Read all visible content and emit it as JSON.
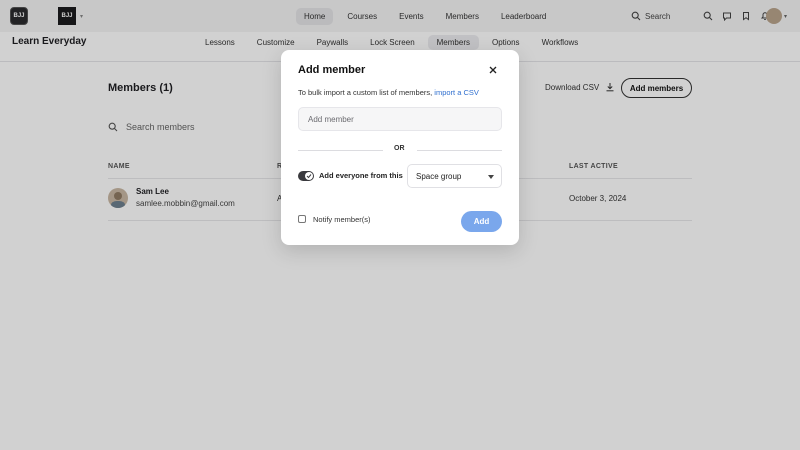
{
  "topnav": {
    "logo_left": "BJJ",
    "logo_right": "BJJ",
    "links": [
      {
        "label": "Home",
        "active": true
      },
      {
        "label": "Courses",
        "active": false
      },
      {
        "label": "Events",
        "active": false
      },
      {
        "label": "Members",
        "active": false
      },
      {
        "label": "Leaderboard",
        "active": false
      }
    ],
    "search_label": "Search",
    "icons": [
      "search-icon",
      "bell-icon",
      "chat-icon",
      "bookmark-icon"
    ]
  },
  "subnav": {
    "title": "Learn Everyday",
    "tabs": [
      {
        "label": "Lessons",
        "active": false
      },
      {
        "label": "Customize",
        "active": false
      },
      {
        "label": "Paywalls",
        "active": false
      },
      {
        "label": "Lock Screen",
        "active": false
      },
      {
        "label": "Members",
        "active": true
      },
      {
        "label": "Options",
        "active": false
      },
      {
        "label": "Workflows",
        "active": false
      }
    ]
  },
  "main": {
    "title": "Members (1)",
    "download_csv": "Download CSV",
    "add_members": "Add members",
    "search_placeholder": "Search members",
    "columns": {
      "name": "NAME",
      "role": "R",
      "last_active": "LAST ACTIVE"
    },
    "rows": [
      {
        "name": "Sam Lee",
        "email": "samlee.mobbin@gmail.com",
        "role": "A",
        "last_active": "October 3, 2024"
      }
    ]
  },
  "modal": {
    "title": "Add member",
    "desc_prefix": "To bulk import a custom list of members, ",
    "desc_link": "import a CSV",
    "input_placeholder": "Add member",
    "or_text": "OR",
    "toggle_label": "Add everyone from this",
    "toggle_on": true,
    "select_value": "Space group",
    "notify_label": "Notify member(s)",
    "add_button": "Add"
  },
  "colors": {
    "accent_link": "#2f6fcf",
    "add_button_bg": "#7aa7ec",
    "toggle_bg": "#3a3a3e"
  }
}
